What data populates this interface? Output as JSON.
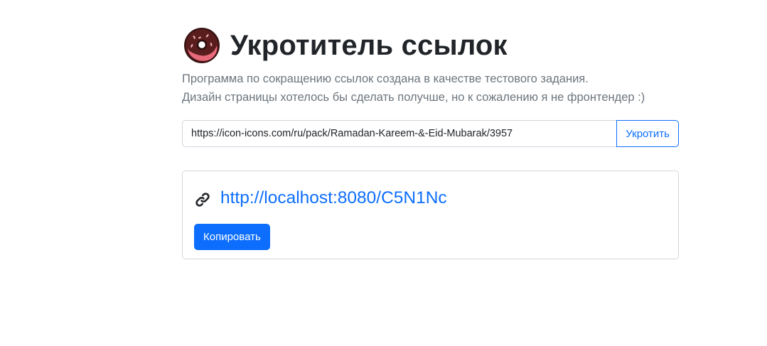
{
  "header": {
    "logo_icon": "donut-icon",
    "title": "Укротитель ссылок",
    "description_line1": "Программа по сокращению ссылок создана в качестве тестового задания.",
    "description_line2": "Дизайн страницы хотелось бы сделать получше, но к сожалению я не фронтендер :)"
  },
  "form": {
    "url_value": "https://icon-icons.com/ru/pack/Ramadan-Kareem-&-Eid-Mubarak/3957",
    "submit_label": "Укротить"
  },
  "result": {
    "link_icon": "link-icon",
    "short_url": "http://localhost:8080/C5N1Nc",
    "copy_label": "Копировать"
  },
  "colors": {
    "primary": "#0d6efd",
    "muted_text": "#6c757d",
    "heading": "#212529",
    "border": "#ced4da"
  }
}
